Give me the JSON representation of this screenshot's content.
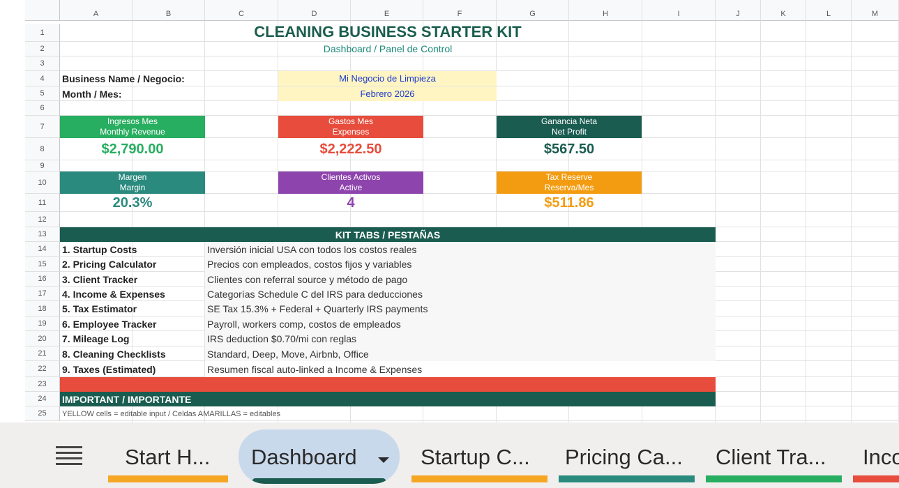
{
  "columns": [
    "A",
    "B",
    "C",
    "D",
    "E",
    "F",
    "G",
    "H",
    "I",
    "J",
    "K",
    "L",
    "M"
  ],
  "rows": [
    "1",
    "2",
    "3",
    "4",
    "5",
    "6",
    "7",
    "8",
    "9",
    "10",
    "11",
    "12",
    "13",
    "14",
    "15",
    "16",
    "17",
    "18",
    "19",
    "20",
    "21",
    "22",
    "23",
    "24",
    "25"
  ],
  "title": "CLEANING BUSINESS STARTER KIT",
  "subtitle": "Dashboard / Panel de Control",
  "business_label": "Business Name / Negocio:",
  "business_value": "Mi Negocio de Limpieza",
  "month_label": "Month / Mes:",
  "month_value": "Febrero 2026",
  "kpis": [
    {
      "line1": "Ingresos Mes",
      "line2": "Monthly Revenue",
      "value": "$2,790.00",
      "color": "#27ae60"
    },
    {
      "line1": "Gastos Mes",
      "line2": "Expenses",
      "value": "$2,222.50",
      "color": "#e74c3c"
    },
    {
      "line1": "Ganancia Neta",
      "line2": "Net Profit",
      "value": "$567.50",
      "color": "#1a5c50"
    },
    {
      "line1": "Margen",
      "line2": "Margin",
      "value": "20.3%",
      "color": "#2a8a7e"
    },
    {
      "line1": "Clientes Activos",
      "line2": "Active",
      "value": "4",
      "color": "#8e44ad"
    },
    {
      "line1": "Tax Reserve",
      "line2": "Reserva/Mes",
      "value": "$511.86",
      "color": "#f39c12"
    }
  ],
  "kit_header": "KIT TABS / PESTAÑAS",
  "kit_tabs": [
    {
      "name": "1. Startup Costs",
      "desc": "Inversión inicial USA con todos los costos reales"
    },
    {
      "name": "2. Pricing Calculator",
      "desc": "Precios con empleados, costos fijos y variables"
    },
    {
      "name": "3. Client Tracker",
      "desc": "Clientes con referral source y método de pago"
    },
    {
      "name": "4. Income & Expenses",
      "desc": "Categorías Schedule C del IRS para deducciones"
    },
    {
      "name": "5. Tax Estimator",
      "desc": "SE Tax 15.3% + Federal + Quarterly IRS payments"
    },
    {
      "name": "6. Employee Tracker",
      "desc": "Payroll, workers comp, costos de empleados"
    },
    {
      "name": "7. Mileage Log",
      "desc": "IRS deduction $0.70/mi con reglas"
    },
    {
      "name": "8. Cleaning Checklists",
      "desc": "Standard, Deep, Move, Airbnb, Office"
    },
    {
      "name": "9. Taxes (Estimated)",
      "desc": "Resumen fiscal auto-linked a Income & Expenses"
    }
  ],
  "important_header": "IMPORTANT / IMPORTANTE",
  "important_note": "YELLOW cells = editable input / Celdas AMARILLAS = editables",
  "sheet_tabs": [
    {
      "label": "Start H...",
      "color": "#f5a623",
      "active": false
    },
    {
      "label": "Dashboard",
      "color": "#1a5c50",
      "active": true
    },
    {
      "label": "Startup C...",
      "color": "#f5a623",
      "active": false
    },
    {
      "label": "Pricing Ca...",
      "color": "#2a8a7e",
      "active": false
    },
    {
      "label": "Client Tra...",
      "color": "#27ae60",
      "active": false
    },
    {
      "label": "Inco",
      "color": "#e74c3c",
      "active": false
    }
  ],
  "colors": {
    "title": "#1b5e4e",
    "dark_green": "#1a5c50",
    "red": "#e74c3c",
    "yellow_input": "#fff5c2",
    "tab_active_bg": "#c9d9ec"
  }
}
